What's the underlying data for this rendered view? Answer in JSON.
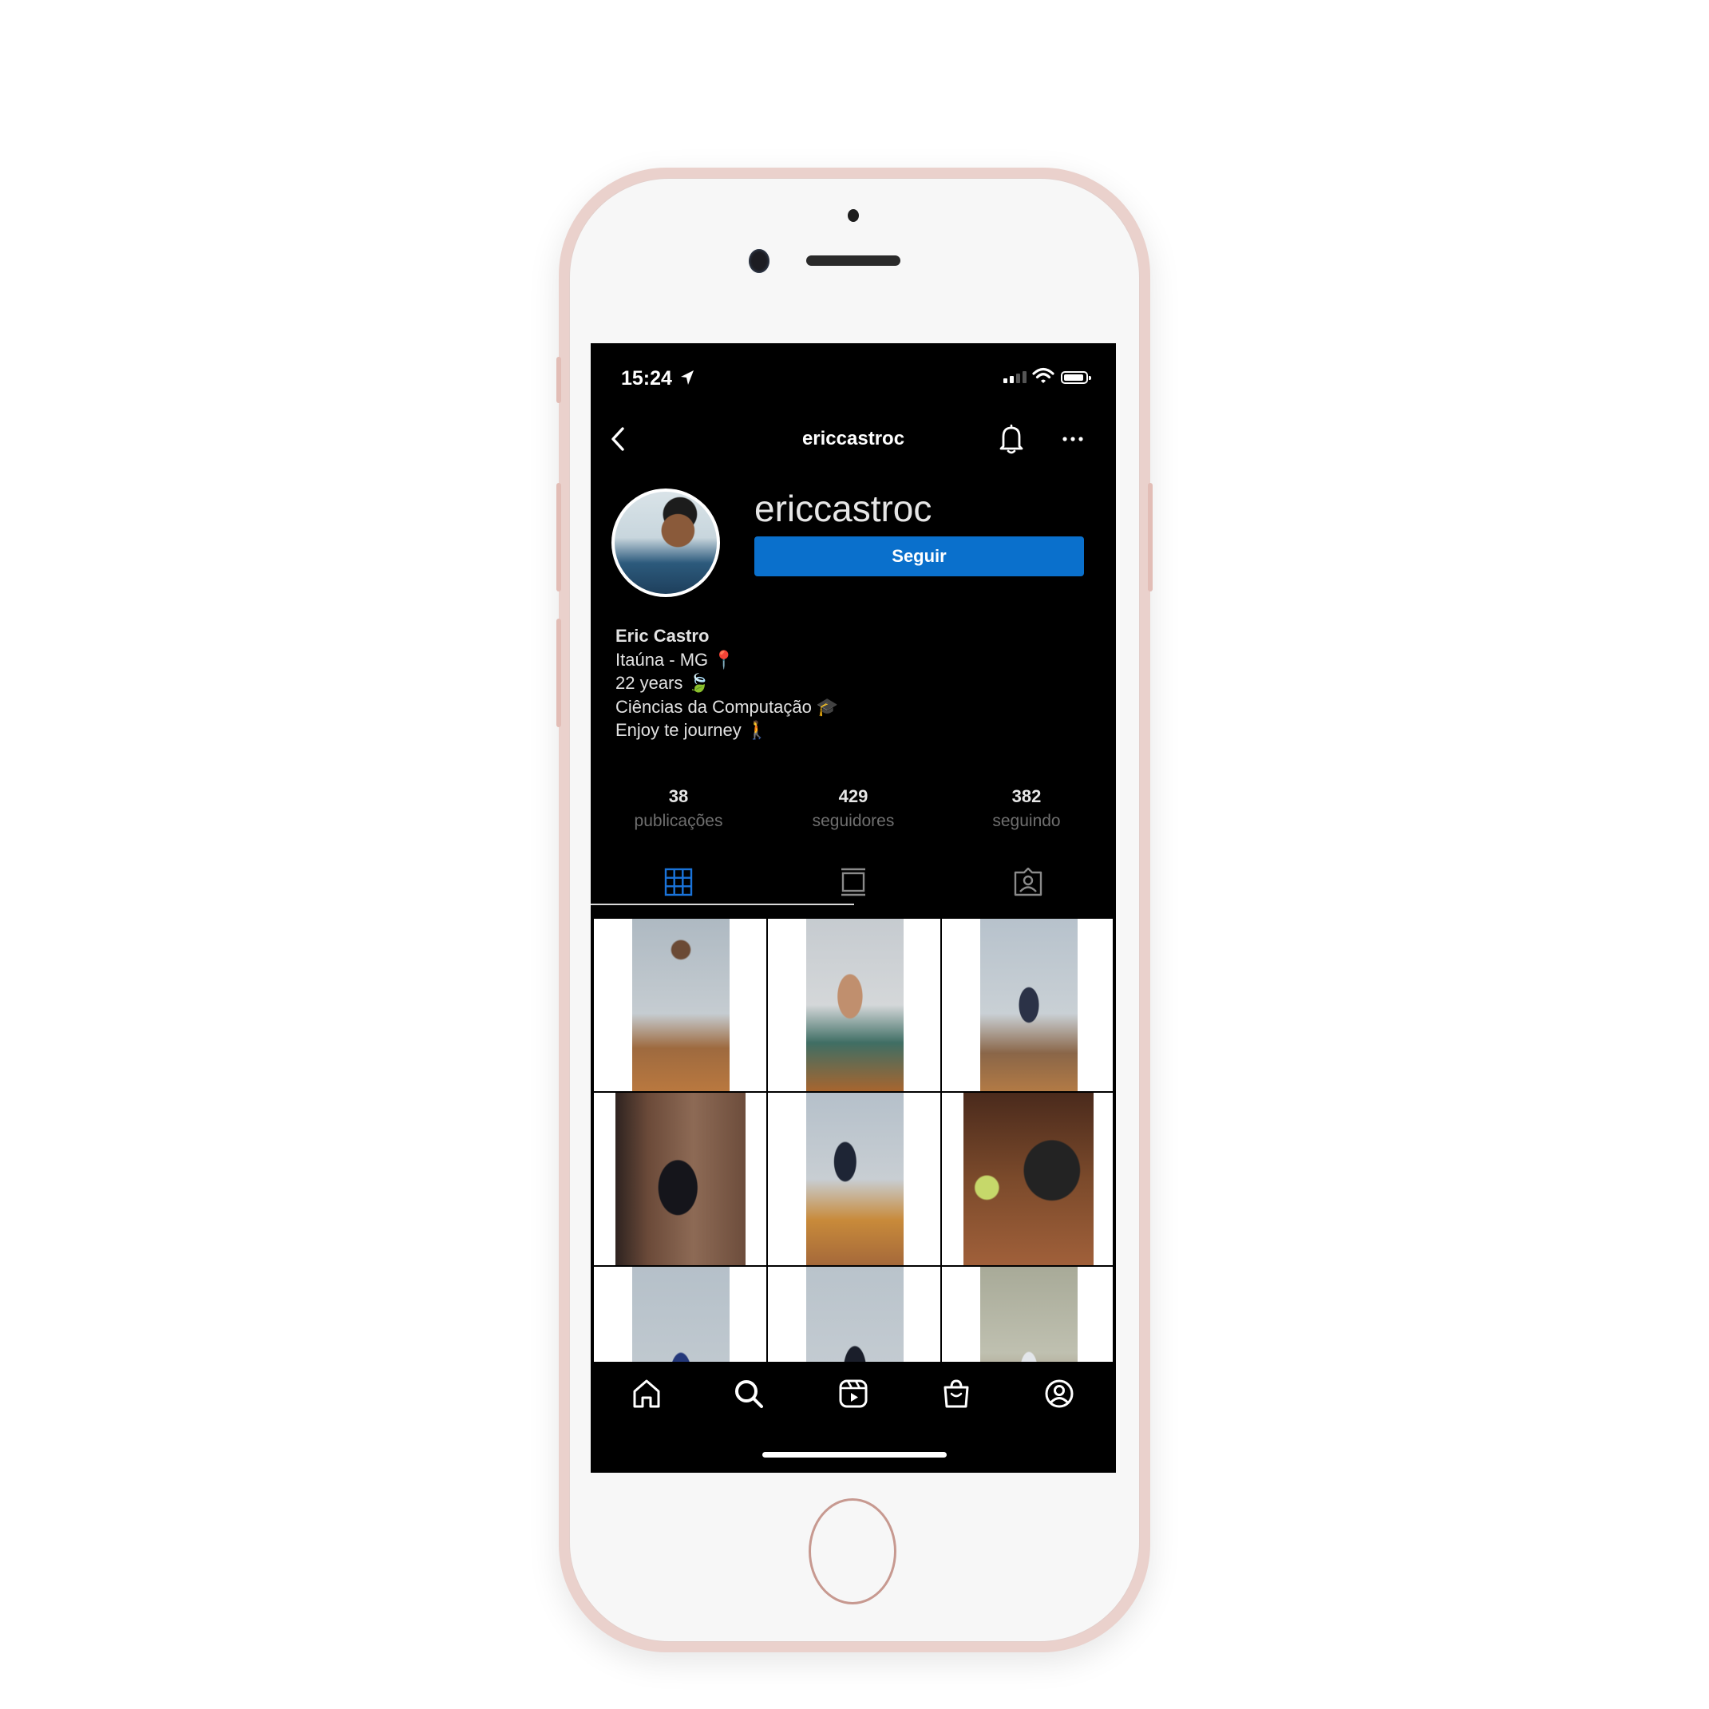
{
  "status_bar": {
    "time": "15:24"
  },
  "header": {
    "username": "ericcastroc"
  },
  "profile": {
    "display_name": "ericcastroc",
    "follow_label": "Seguir",
    "bio": {
      "name": "Eric Castro",
      "line1": "Itaúna - MG 📍",
      "line2": "22 years 🍃",
      "line3": "Ciências da Computação 🎓",
      "line4": "Enjoy te journey 🚶"
    }
  },
  "stats": [
    {
      "value": "38",
      "label": "publicações"
    },
    {
      "value": "429",
      "label": "seguidores"
    },
    {
      "value": "382",
      "label": "seguindo"
    }
  ],
  "tabs": {
    "selected": "grid",
    "icons": [
      "grid-icon",
      "feed-icon",
      "tagged-icon"
    ]
  },
  "colors": {
    "accent": "#0a70cc",
    "background": "#000000",
    "muted_text": "#6f6f6f",
    "phone_body": "#ead1cc"
  },
  "bottom_nav": {
    "icons": [
      "home-icon",
      "search-icon",
      "reels-icon",
      "shop-icon",
      "profile-icon"
    ]
  }
}
